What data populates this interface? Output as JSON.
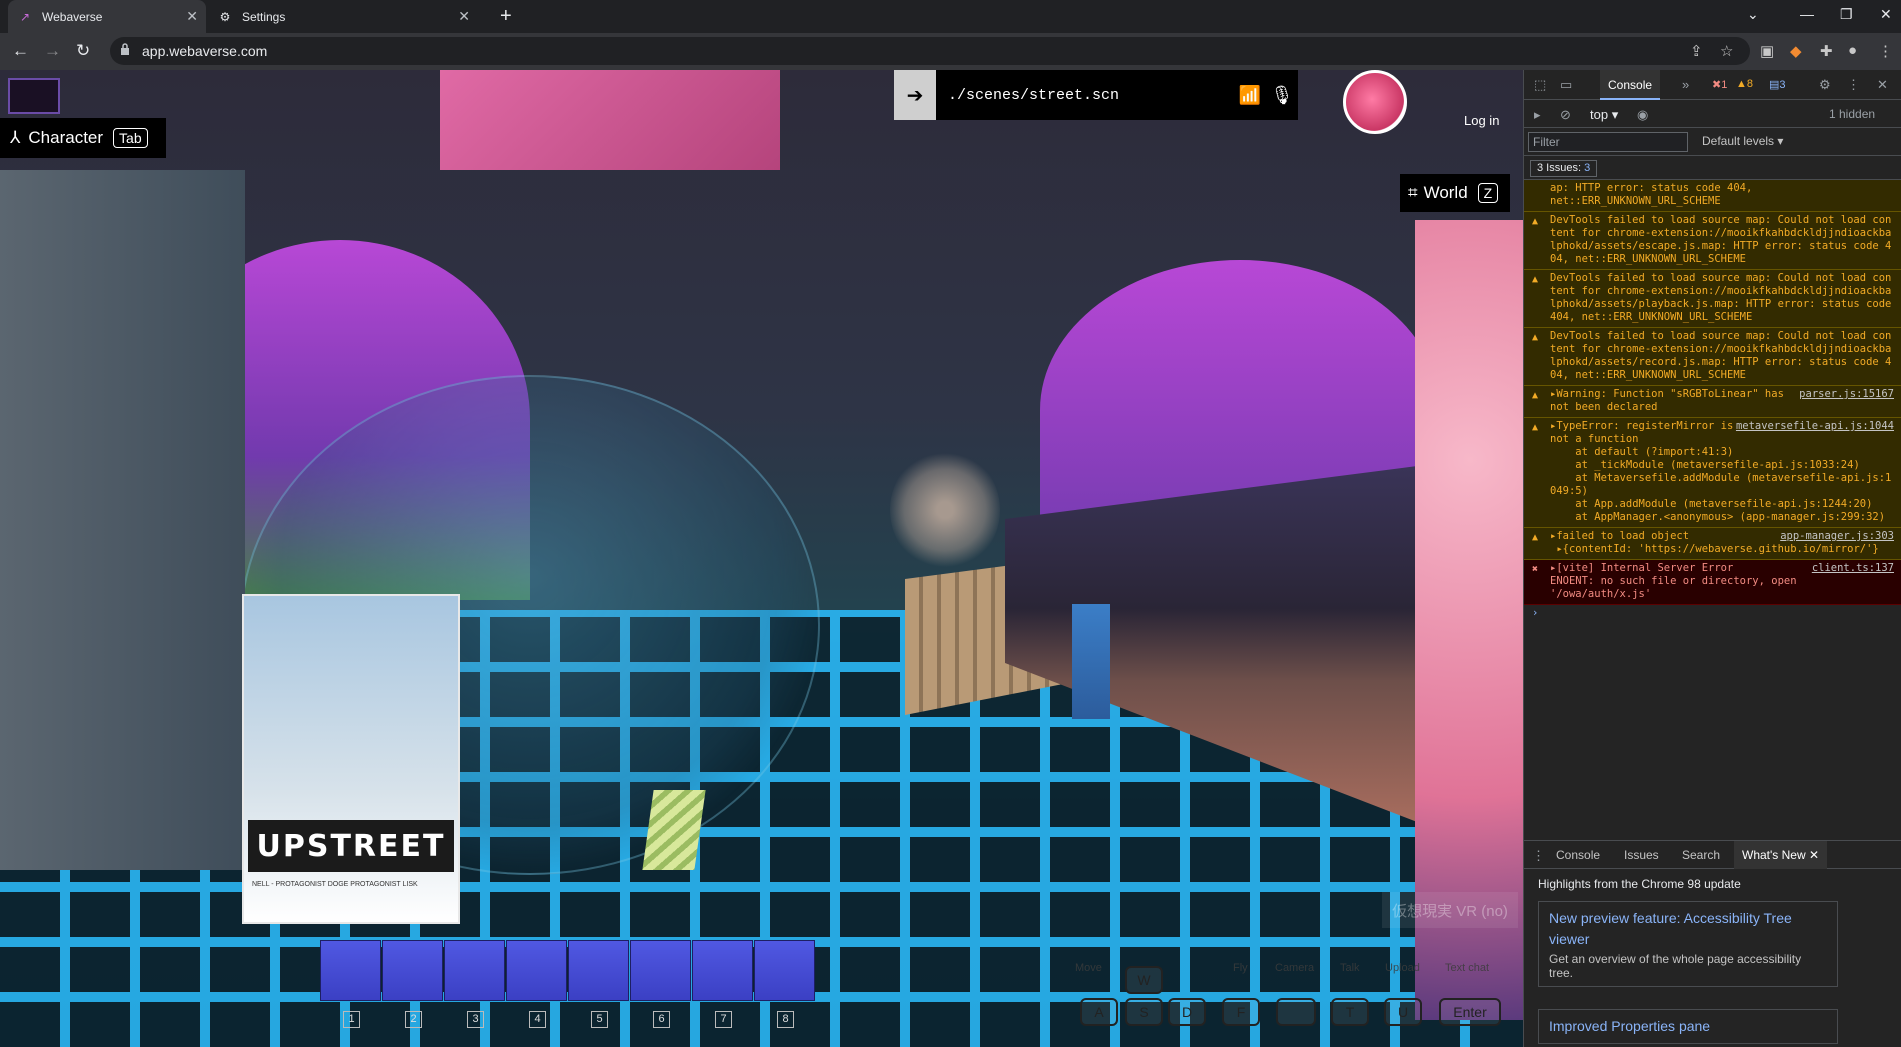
{
  "browser": {
    "tabs": [
      {
        "title": "Webaverse",
        "active": true
      },
      {
        "title": "Settings",
        "active": false
      }
    ],
    "url": "app.webaverse.com"
  },
  "hud": {
    "character_label": "Character",
    "character_key": "Tab",
    "scene_path": "./scenes/street.scn",
    "login_label": "Log in",
    "world_label": "World",
    "world_key": "Z",
    "vr_label": "仮想現実 VR (no)",
    "hotbar_numbers": [
      "1",
      "2",
      "3",
      "4",
      "5",
      "6",
      "7",
      "8"
    ],
    "key_labels": [
      "Move",
      "Fly",
      "Camera",
      "Talk",
      "Upload",
      "Text chat"
    ],
    "keycaps": [
      "W",
      "A",
      "S",
      "D",
      "F",
      "",
      "T",
      "U",
      "Enter"
    ]
  },
  "poster": {
    "logo": "UPSTREET",
    "credits": "NELL - PROTAGONIST   DOGE   PROTAGONIST   LISK"
  },
  "devtools": {
    "active_tab": "Console",
    "error_count": "1",
    "warning_count": "8",
    "info_count": "3",
    "context": "top",
    "hidden_label": "1 hidden",
    "filter_placeholder": "Filter",
    "levels_label": "Default levels",
    "issues_label": "3 Issues:",
    "issues_count": "3",
    "messages": [
      {
        "level": "warning",
        "text": "ap: HTTP error: status code 404, net::ERR_UNKNOWN_URL_SCHEME",
        "source": ""
      },
      {
        "level": "warning",
        "text": "DevTools failed to load source map: Could not load content for chrome-extension://mooikfkahbdckldjjndioackbalphokd/assets/escape.js.map: HTTP error: status code 404, net::ERR_UNKNOWN_URL_SCHEME",
        "source": ""
      },
      {
        "level": "warning",
        "text": "DevTools failed to load source map: Could not load content for chrome-extension://mooikfkahbdckldjjndioackbalphokd/assets/playback.js.map: HTTP error: status code 404, net::ERR_UNKNOWN_URL_SCHEME",
        "source": ""
      },
      {
        "level": "warning",
        "text": "DevTools failed to load source map: Could not load content for chrome-extension://mooikfkahbdckldjjndioackbalphokd/assets/record.js.map: HTTP error: status code 404, net::ERR_UNKNOWN_URL_SCHEME",
        "source": ""
      },
      {
        "level": "warning",
        "text": "▸Warning: Function \"sRGBToLinear\" has not been declared",
        "source": "parser.js:15167"
      },
      {
        "level": "warning",
        "text": "▸TypeError: registerMirror is not a function\n    at default (?import:41:3)\n    at _tickModule (metaversefile-api.js:1033:24)\n    at Metaversefile.addModule (metaversefile-api.js:1049:5)\n    at App.addModule (metaversefile-api.js:1244:20)\n    at AppManager.<anonymous> (app-manager.js:299:32)",
        "source": "metaversefile-api.js:1044"
      },
      {
        "level": "warning",
        "text": "▸failed to load object\n ▸{contentId: 'https://webaverse.github.io/mirror/'}",
        "source": "app-manager.js:303"
      },
      {
        "level": "error",
        "text": "▸[vite] Internal Server Error\nENOENT: no such file or directory, open '/owa/auth/x.js'",
        "source": "client.ts:137"
      }
    ],
    "drawer_tabs": [
      "Console",
      "Issues",
      "Search",
      "What's New"
    ],
    "whats_new_heading": "Highlights from the Chrome 98 update",
    "whats_new_cards": [
      {
        "title": "New preview feature: Accessibility Tree viewer",
        "desc": "Get an overview of the whole page accessibility tree."
      },
      {
        "title": "Improved Properties pane",
        "desc": ""
      }
    ]
  }
}
